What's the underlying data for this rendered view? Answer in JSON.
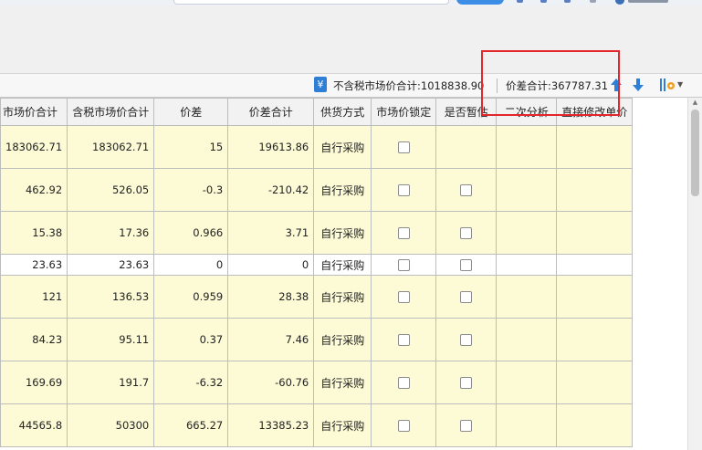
{
  "status": {
    "total_excl_tax": "不含税市场价合计:1018838.90",
    "price_diff_total": "价差合计:367787.31",
    "money_icon": "¥",
    "icons": [
      "money-icon",
      "arrow-up-icon",
      "arrow-down-icon",
      "settings-icon"
    ]
  },
  "table": {
    "headers": [
      "市场价合计",
      "含税市场价合计",
      "价差",
      "价差合计",
      "供货方式",
      "市场价锁定",
      "是否暂估",
      "二次分析",
      "直接修改单价"
    ],
    "rows": [
      {
        "market_total": "183062.71",
        "tax_market_total": "183062.71",
        "diff": "15",
        "diff_total": "19613.86",
        "supply": "自行采购",
        "lock": false,
        "estimate_checkbox": false
      },
      {
        "market_total": "462.92",
        "tax_market_total": "526.05",
        "diff": "-0.3",
        "diff_total": "-210.42",
        "supply": "自行采购",
        "lock": false,
        "estimate_checkbox": true
      },
      {
        "market_total": "15.38",
        "tax_market_total": "17.36",
        "diff": "0.966",
        "diff_total": "3.71",
        "supply": "自行采购",
        "lock": false,
        "estimate_checkbox": true
      },
      {
        "market_total": "23.63",
        "tax_market_total": "23.63",
        "diff": "0",
        "diff_total": "0",
        "supply": "自行采购",
        "lock": false,
        "estimate_checkbox": true
      },
      {
        "market_total": "121",
        "tax_market_total": "136.53",
        "diff": "0.959",
        "diff_total": "28.38",
        "supply": "自行采购",
        "lock": false,
        "estimate_checkbox": true
      },
      {
        "market_total": "84.23",
        "tax_market_total": "95.11",
        "diff": "0.37",
        "diff_total": "7.46",
        "supply": "自行采购",
        "lock": false,
        "estimate_checkbox": true
      },
      {
        "market_total": "169.69",
        "tax_market_total": "191.7",
        "diff": "-6.32",
        "diff_total": "-60.76",
        "supply": "自行采购",
        "lock": false,
        "estimate_checkbox": true
      },
      {
        "market_total": "44565.8",
        "tax_market_total": "50300",
        "diff": "665.27",
        "diff_total": "13385.23",
        "supply": "自行采购",
        "lock": false,
        "estimate_checkbox": true
      }
    ]
  },
  "colors": {
    "row_bg": "#fdfbd5",
    "header_bg": "#f2f2f2",
    "highlight_border": "#e3262b",
    "icon_blue": "#2f7fd6"
  }
}
